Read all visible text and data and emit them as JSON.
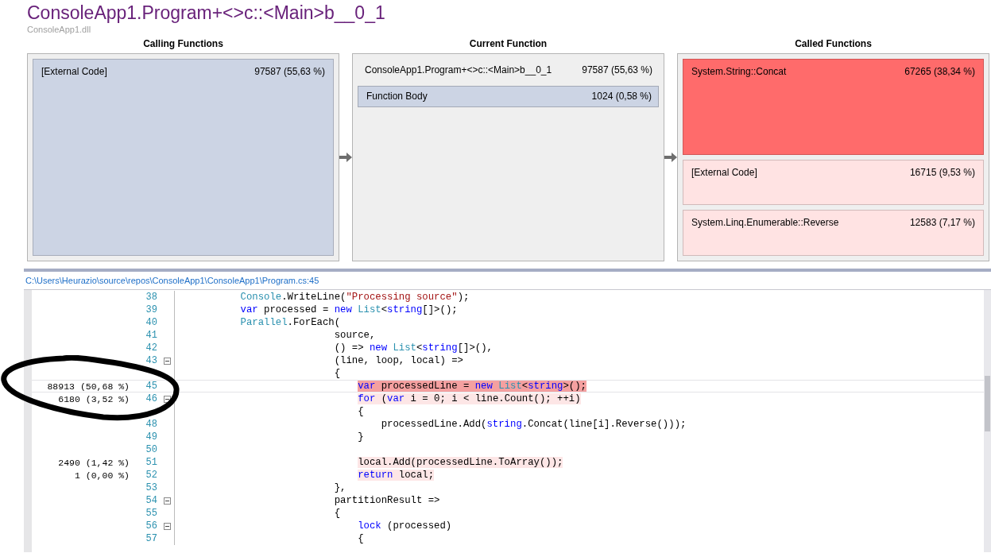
{
  "title": "ConsoleApp1.Program+<>c::<Main>b__0_1",
  "module": "ConsoleApp1.dll",
  "panels": [
    {
      "heading": "Calling Functions",
      "kind": "calling",
      "items": [
        {
          "name": "[External Code]",
          "value": "97587 (55,63 %)",
          "color": "#ccd4e4"
        }
      ]
    },
    {
      "heading": "Current Function",
      "kind": "current",
      "function": {
        "name": "ConsoleApp1.Program+<>c::<Main>b__0_1",
        "value": "97587 (55,63 %)"
      },
      "items": [
        {
          "name": "Function Body",
          "value": "1024 (0,58 %)",
          "color": "#ccd4e4"
        }
      ]
    },
    {
      "heading": "Called Functions",
      "kind": "called",
      "items": [
        {
          "name": "System.String::Concat",
          "value": "67265 (38,34 %)",
          "color": "#ff6b6b"
        },
        {
          "name": "[External Code]",
          "value": "16715 (9,53 %)",
          "color": "#ffe3e3"
        },
        {
          "name": "System.Linq.Enumerable::Reverse",
          "value": "12583 (7,17 %)",
          "color": "#ffe3e3"
        }
      ]
    }
  ],
  "file_path": "C:\\Users\\Heurazio\\source\\repos\\ConsoleApp1\\ConsoleApp1\\Program.cs:45",
  "lines": [
    {
      "number": "38",
      "foldable": false,
      "selected": false,
      "tokens": [
        {
          "text": "            Console",
          "kind": "type"
        },
        {
          "text": ".WriteLine(",
          "kind": "plain"
        },
        {
          "text": "\"Processing source\"",
          "kind": "string"
        },
        {
          "text": ");",
          "kind": "plain"
        }
      ]
    },
    {
      "number": "39",
      "foldable": false,
      "selected": false,
      "tokens": [
        {
          "text": "            var",
          "kind": "keyword"
        },
        {
          "text": " processed = ",
          "kind": "plain"
        },
        {
          "text": "new",
          "kind": "keyword"
        },
        {
          "text": " List",
          "kind": "type"
        },
        {
          "text": "<",
          "kind": "plain"
        },
        {
          "text": "string",
          "kind": "keyword"
        },
        {
          "text": "[]>();",
          "kind": "plain"
        }
      ]
    },
    {
      "number": "40",
      "foldable": false,
      "selected": false,
      "tokens": [
        {
          "text": "            Parallel",
          "kind": "type"
        },
        {
          "text": ".ForEach(",
          "kind": "plain"
        }
      ]
    },
    {
      "number": "41",
      "foldable": false,
      "selected": false,
      "tokens": [
        {
          "text": "                            source,",
          "kind": "plain"
        }
      ]
    },
    {
      "number": "42",
      "foldable": false,
      "selected": false,
      "tokens": [
        {
          "text": "                            () => ",
          "kind": "plain"
        },
        {
          "text": "new",
          "kind": "keyword"
        },
        {
          "text": " List",
          "kind": "type"
        },
        {
          "text": "<",
          "kind": "plain"
        },
        {
          "text": "string",
          "kind": "keyword"
        },
        {
          "text": "[]>(),",
          "kind": "plain"
        }
      ]
    },
    {
      "number": "43",
      "foldable": true,
      "selected": false,
      "tokens": [
        {
          "text": "                            (line, loop, local) =>",
          "kind": "plain"
        }
      ]
    },
    {
      "foldable": false,
      "selected": false,
      "tokens": [
        {
          "text": "                            {",
          "kind": "plain"
        }
      ]
    },
    {
      "number": "45",
      "count": "88913 (50,68 %)",
      "foldable": false,
      "selected": true,
      "tokens": [
        {
          "text": "                                var",
          "kind": "keyword",
          "color": "#f4a0a0"
        },
        {
          "text": " processedLine = ",
          "kind": "plain",
          "color": "#f4a0a0"
        },
        {
          "text": "new",
          "kind": "keyword",
          "color": "#f4a0a0"
        },
        {
          "text": " List",
          "kind": "type",
          "color": "#f4a0a0"
        },
        {
          "text": "<",
          "kind": "plain",
          "color": "#f4a0a0"
        },
        {
          "text": "string",
          "kind": "keyword",
          "color": "#f4a0a0"
        },
        {
          "text": ">();",
          "kind": "plain",
          "color": "#f4a0a0"
        }
      ]
    },
    {
      "number": "46",
      "count": "6180 (3,52 %)",
      "foldable": true,
      "selected": false,
      "tokens": [
        {
          "text": "                                for",
          "kind": "keyword",
          "color": "#fde6e6"
        },
        {
          "text": " (",
          "kind": "plain",
          "color": "#fde6e6"
        },
        {
          "text": "var",
          "kind": "keyword",
          "color": "#fde6e6"
        },
        {
          "text": " i = 0;",
          "kind": "plain",
          "color": "#fde6e6"
        },
        {
          "text": " i < line.Count();",
          "kind": "plain",
          "color": "#fde6e6"
        },
        {
          "text": " ++i)",
          "kind": "plain",
          "color": "#fde6e6"
        }
      ]
    },
    {
      "foldable": false,
      "selected": false,
      "tokens": [
        {
          "text": "                                {",
          "kind": "plain"
        }
      ]
    },
    {
      "number": "48",
      "foldable": false,
      "selected": false,
      "tokens": [
        {
          "text": "                                    processedLine.Add(",
          "kind": "plain"
        },
        {
          "text": "string",
          "kind": "keyword"
        },
        {
          "text": ".Concat(line[i].Reverse()));",
          "kind": "plain"
        }
      ]
    },
    {
      "number": "49",
      "foldable": false,
      "selected": false,
      "tokens": [
        {
          "text": "                                }",
          "kind": "plain"
        }
      ]
    },
    {
      "number": "50",
      "foldable": false,
      "selected": false
    },
    {
      "number": "51",
      "count": "2490 (1,42 %)",
      "foldable": false,
      "selected": false,
      "tokens": [
        {
          "text": "                                local.Add(processedLine.ToArray());",
          "kind": "plain",
          "color": "#fde6e6"
        }
      ]
    },
    {
      "number": "52",
      "count": "1 (0,00 %)",
      "foldable": false,
      "selected": false,
      "tokens": [
        {
          "text": "                                return",
          "kind": "keyword",
          "color": "#fde6e6"
        },
        {
          "text": " local;",
          "kind": "plain",
          "color": "#fde6e6"
        }
      ]
    },
    {
      "number": "53",
      "foldable": false,
      "selected": false,
      "tokens": [
        {
          "text": "                            },",
          "kind": "plain"
        }
      ]
    },
    {
      "number": "54",
      "foldable": true,
      "selected": false,
      "tokens": [
        {
          "text": "                            partitionResult =>",
          "kind": "plain"
        }
      ]
    },
    {
      "number": "55",
      "foldable": false,
      "selected": false,
      "tokens": [
        {
          "text": "                            {",
          "kind": "plain"
        }
      ]
    },
    {
      "number": "56",
      "foldable": true,
      "selected": false,
      "tokens": [
        {
          "text": "                                lock",
          "kind": "keyword"
        },
        {
          "text": " (processed)",
          "kind": "plain"
        }
      ]
    },
    {
      "number": "57",
      "foldable": false,
      "selected": false,
      "tokens": [
        {
          "text": "                                {",
          "kind": "plain"
        }
      ]
    }
  ]
}
